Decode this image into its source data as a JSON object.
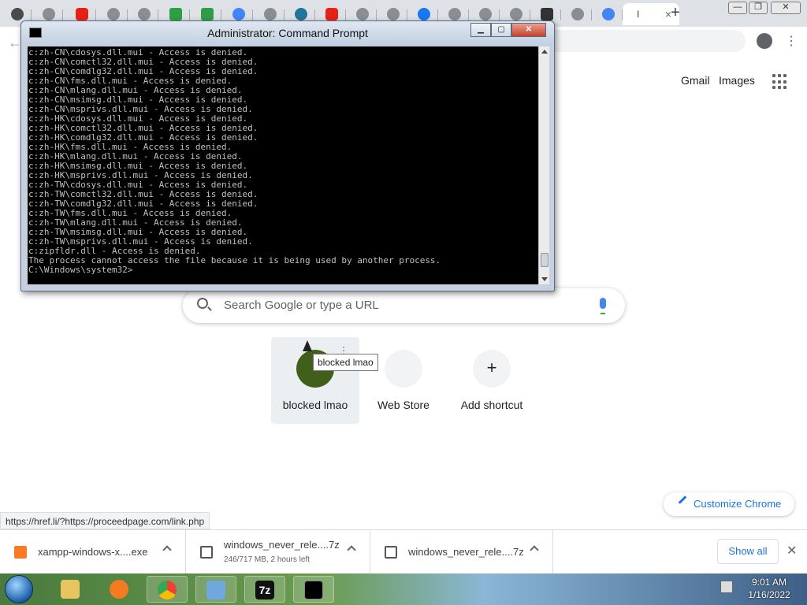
{
  "browser": {
    "tab_title_fragment": "I",
    "tab_close": "×",
    "new_tab": "+",
    "window_controls": {
      "minimize": "—",
      "restore": "❐",
      "close": "✕"
    }
  },
  "google": {
    "gmail": "Gmail",
    "images": "Images",
    "search_placeholder": "Search Google or type a URL",
    "shortcuts": [
      {
        "label": "blocked lmao"
      },
      {
        "label": "Web Store"
      },
      {
        "label": "Add shortcut",
        "icon_text": "+"
      }
    ],
    "tooltip": "blocked lmao",
    "customize": "Customize Chrome"
  },
  "status_url": "https://href.li/?https://proceedpage.com/link.php",
  "downloads": {
    "items": [
      {
        "name": "xampp-windows-x....exe"
      },
      {
        "name": "windows_never_rele....7z",
        "sub": "246/717 MB, 2 hours left"
      },
      {
        "name": "windows_never_rele....7z"
      }
    ],
    "show_all": "Show all",
    "close": "✕"
  },
  "cmd": {
    "title": "Administrator: Command Prompt",
    "lines": [
      "c:zh-CN\\cdosys.dll.mui - Access is denied.",
      "c:zh-CN\\comctl32.dll.mui - Access is denied.",
      "c:zh-CN\\comdlg32.dll.mui - Access is denied.",
      "c:zh-CN\\fms.dll.mui - Access is denied.",
      "c:zh-CN\\mlang.dll.mui - Access is denied.",
      "c:zh-CN\\msimsg.dll.mui - Access is denied.",
      "c:zh-CN\\msprivs.dll.mui - Access is denied.",
      "c:zh-HK\\cdosys.dll.mui - Access is denied.",
      "c:zh-HK\\comctl32.dll.mui - Access is denied.",
      "c:zh-HK\\comdlg32.dll.mui - Access is denied.",
      "c:zh-HK\\fms.dll.mui - Access is denied.",
      "c:zh-HK\\mlang.dll.mui - Access is denied.",
      "c:zh-HK\\msimsg.dll.mui - Access is denied.",
      "c:zh-HK\\msprivs.dll.mui - Access is denied.",
      "c:zh-TW\\cdosys.dll.mui - Access is denied.",
      "c:zh-TW\\comctl32.dll.mui - Access is denied.",
      "c:zh-TW\\comdlg32.dll.mui - Access is denied.",
      "c:zh-TW\\fms.dll.mui - Access is denied.",
      "c:zh-TW\\mlang.dll.mui - Access is denied.",
      "c:zh-TW\\msimsg.dll.mui - Access is denied.",
      "c:zh-TW\\msprivs.dll.mui - Access is denied.",
      "c:zipfldr.dll - Access is denied.",
      "The process cannot access the file because it is being used by another process.",
      "",
      "C:\\Windows\\system32>"
    ]
  },
  "taskbar": {
    "time": "9:01 AM",
    "date": "1/16/2022",
    "app_icons": [
      "explorer-icon",
      "firefox-icon",
      "chrome-icon",
      "control-panel-icon",
      "7zip-icon",
      "cmd-icon"
    ]
  }
}
